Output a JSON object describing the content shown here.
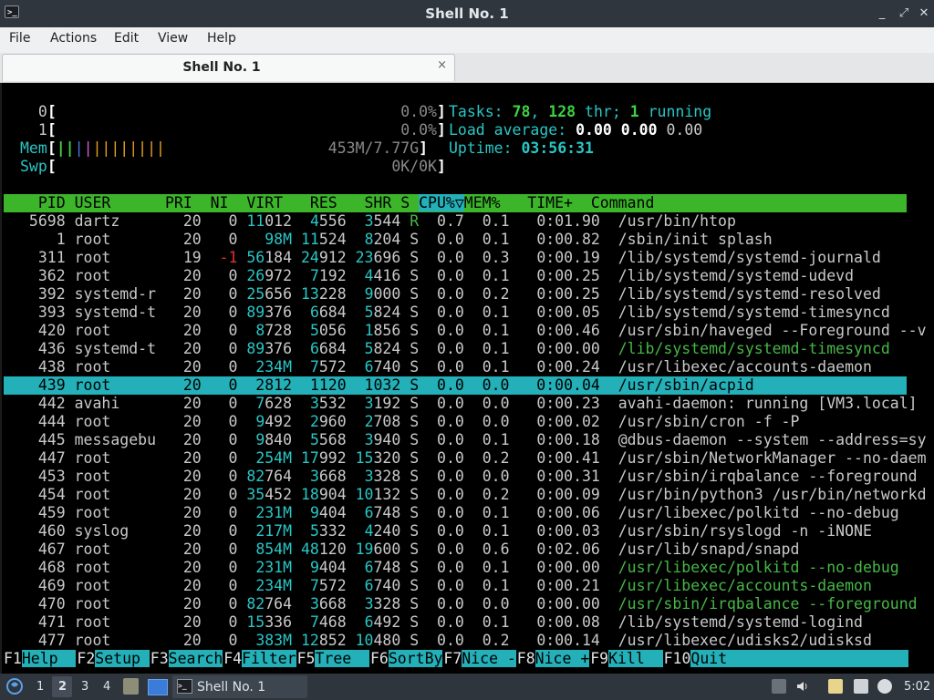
{
  "window": {
    "title": "Shell No. 1",
    "minimize": "_",
    "maximize": "⤢",
    "close": "✕"
  },
  "menu": {
    "items": [
      "File",
      "Actions",
      "Edit",
      "View",
      "Help"
    ]
  },
  "tab": {
    "label": "Shell No. 1",
    "close": "×"
  },
  "htop": {
    "cpu0": {
      "label": "0",
      "value": "0.0%"
    },
    "cpu1": {
      "label": "1",
      "value": "0.0%"
    },
    "mem": {
      "label": "Mem",
      "value": "453M/7.77G"
    },
    "swp": {
      "label": "Swp",
      "value": "0K/0K"
    },
    "tasks": {
      "label": "Tasks:",
      "count": "78",
      "thr": "128",
      "thr_label": "thr;",
      "running": "1",
      "running_label": "running"
    },
    "load": {
      "label": "Load average:",
      "v1": "0.00",
      "v2": "0.00",
      "v3": "0.00"
    },
    "uptime": {
      "label": "Uptime:",
      "value": "03:56:31"
    },
    "header": "  PID USER      PRI  NI  VIRT   RES   SHR S CPU%▽MEM%   TIME+  Command",
    "selected_pid": "439",
    "processes": [
      {
        "pid": "5698",
        "user": "dartz",
        "pri": "20",
        "ni": "0",
        "virt": "11012",
        "res": "4556",
        "shr": "3544",
        "s": "R",
        "cpu": "0.7",
        "mem": "0.1",
        "time": "0:01.90",
        "cmd": "/usr/bin/htop"
      },
      {
        "pid": "1",
        "user": "root",
        "pri": "20",
        "ni": "0",
        "virt": "98M",
        "res": "11524",
        "shr": "8204",
        "s": "S",
        "cpu": "0.0",
        "mem": "0.1",
        "time": "0:00.82",
        "cmd": "/sbin/init splash"
      },
      {
        "pid": "311",
        "user": "root",
        "pri": "19",
        "ni": "-1",
        "virt": "56184",
        "res": "24912",
        "shr": "23696",
        "s": "S",
        "cpu": "0.0",
        "mem": "0.3",
        "time": "0:00.19",
        "cmd": "/lib/systemd/systemd-journald"
      },
      {
        "pid": "362",
        "user": "root",
        "pri": "20",
        "ni": "0",
        "virt": "26972",
        "res": "7192",
        "shr": "4416",
        "s": "S",
        "cpu": "0.0",
        "mem": "0.1",
        "time": "0:00.25",
        "cmd": "/lib/systemd/systemd-udevd"
      },
      {
        "pid": "392",
        "user": "systemd-r",
        "pri": "20",
        "ni": "0",
        "virt": "25656",
        "res": "13228",
        "shr": "9000",
        "s": "S",
        "cpu": "0.0",
        "mem": "0.2",
        "time": "0:00.25",
        "cmd": "/lib/systemd/systemd-resolved"
      },
      {
        "pid": "393",
        "user": "systemd-t",
        "pri": "20",
        "ni": "0",
        "virt": "89376",
        "res": "6684",
        "shr": "5824",
        "s": "S",
        "cpu": "0.0",
        "mem": "0.1",
        "time": "0:00.05",
        "cmd": "/lib/systemd/systemd-timesyncd"
      },
      {
        "pid": "420",
        "user": "root",
        "pri": "20",
        "ni": "0",
        "virt": "8728",
        "res": "5056",
        "shr": "1856",
        "s": "S",
        "cpu": "0.0",
        "mem": "0.1",
        "time": "0:00.46",
        "cmd": "/usr/sbin/haveged --Foreground --v"
      },
      {
        "pid": "436",
        "user": "systemd-t",
        "pri": "20",
        "ni": "0",
        "virt": "89376",
        "res": "6684",
        "shr": "5824",
        "s": "S",
        "cpu": "0.0",
        "mem": "0.1",
        "time": "0:00.00",
        "cmd": "/lib/systemd/systemd-timesyncd",
        "thread": true
      },
      {
        "pid": "438",
        "user": "root",
        "pri": "20",
        "ni": "0",
        "virt": "234M",
        "res": "7572",
        "shr": "6740",
        "s": "S",
        "cpu": "0.0",
        "mem": "0.1",
        "time": "0:00.24",
        "cmd": "/usr/libexec/accounts-daemon"
      },
      {
        "pid": "439",
        "user": "root",
        "pri": "20",
        "ni": "0",
        "virt": "2812",
        "res": "1120",
        "shr": "1032",
        "s": "S",
        "cpu": "0.0",
        "mem": "0.0",
        "time": "0:00.04",
        "cmd": "/usr/sbin/acpid"
      },
      {
        "pid": "442",
        "user": "avahi",
        "pri": "20",
        "ni": "0",
        "virt": "7628",
        "res": "3532",
        "shr": "3192",
        "s": "S",
        "cpu": "0.0",
        "mem": "0.0",
        "time": "0:00.23",
        "cmd": "avahi-daemon: running [VM3.local]"
      },
      {
        "pid": "444",
        "user": "root",
        "pri": "20",
        "ni": "0",
        "virt": "9492",
        "res": "2960",
        "shr": "2708",
        "s": "S",
        "cpu": "0.0",
        "mem": "0.0",
        "time": "0:00.02",
        "cmd": "/usr/sbin/cron -f -P"
      },
      {
        "pid": "445",
        "user": "messagebu",
        "pri": "20",
        "ni": "0",
        "virt": "9840",
        "res": "5568",
        "shr": "3940",
        "s": "S",
        "cpu": "0.0",
        "mem": "0.1",
        "time": "0:00.18",
        "cmd": "@dbus-daemon --system --address=sy"
      },
      {
        "pid": "447",
        "user": "root",
        "pri": "20",
        "ni": "0",
        "virt": "254M",
        "res": "17992",
        "shr": "15320",
        "s": "S",
        "cpu": "0.0",
        "mem": "0.2",
        "time": "0:00.41",
        "cmd": "/usr/sbin/NetworkManager --no-daem"
      },
      {
        "pid": "453",
        "user": "root",
        "pri": "20",
        "ni": "0",
        "virt": "82764",
        "res": "3668",
        "shr": "3328",
        "s": "S",
        "cpu": "0.0",
        "mem": "0.0",
        "time": "0:00.31",
        "cmd": "/usr/sbin/irqbalance --foreground"
      },
      {
        "pid": "454",
        "user": "root",
        "pri": "20",
        "ni": "0",
        "virt": "35452",
        "res": "18904",
        "shr": "10132",
        "s": "S",
        "cpu": "0.0",
        "mem": "0.2",
        "time": "0:00.09",
        "cmd": "/usr/bin/python3 /usr/bin/networkd"
      },
      {
        "pid": "459",
        "user": "root",
        "pri": "20",
        "ni": "0",
        "virt": "231M",
        "res": "9404",
        "shr": "6748",
        "s": "S",
        "cpu": "0.0",
        "mem": "0.1",
        "time": "0:00.06",
        "cmd": "/usr/libexec/polkitd --no-debug"
      },
      {
        "pid": "460",
        "user": "syslog",
        "pri": "20",
        "ni": "0",
        "virt": "217M",
        "res": "5332",
        "shr": "4240",
        "s": "S",
        "cpu": "0.0",
        "mem": "0.1",
        "time": "0:00.03",
        "cmd": "/usr/sbin/rsyslogd -n -iNONE"
      },
      {
        "pid": "467",
        "user": "root",
        "pri": "20",
        "ni": "0",
        "virt": "854M",
        "res": "48120",
        "shr": "19600",
        "s": "S",
        "cpu": "0.0",
        "mem": "0.6",
        "time": "0:02.06",
        "cmd": "/usr/lib/snapd/snapd"
      },
      {
        "pid": "468",
        "user": "root",
        "pri": "20",
        "ni": "0",
        "virt": "231M",
        "res": "9404",
        "shr": "6748",
        "s": "S",
        "cpu": "0.0",
        "mem": "0.1",
        "time": "0:00.00",
        "cmd": "/usr/libexec/polkitd --no-debug",
        "thread": true
      },
      {
        "pid": "469",
        "user": "root",
        "pri": "20",
        "ni": "0",
        "virt": "234M",
        "res": "7572",
        "shr": "6740",
        "s": "S",
        "cpu": "0.0",
        "mem": "0.1",
        "time": "0:00.21",
        "cmd": "/usr/libexec/accounts-daemon",
        "thread": true
      },
      {
        "pid": "470",
        "user": "root",
        "pri": "20",
        "ni": "0",
        "virt": "82764",
        "res": "3668",
        "shr": "3328",
        "s": "S",
        "cpu": "0.0",
        "mem": "0.0",
        "time": "0:00.00",
        "cmd": "/usr/sbin/irqbalance --foreground",
        "thread": true
      },
      {
        "pid": "471",
        "user": "root",
        "pri": "20",
        "ni": "0",
        "virt": "15336",
        "res": "7468",
        "shr": "6492",
        "s": "S",
        "cpu": "0.0",
        "mem": "0.1",
        "time": "0:00.08",
        "cmd": "/lib/systemd/systemd-logind"
      },
      {
        "pid": "477",
        "user": "root",
        "pri": "20",
        "ni": "0",
        "virt": "383M",
        "res": "12852",
        "shr": "10480",
        "s": "S",
        "cpu": "0.0",
        "mem": "0.2",
        "time": "0:00.14",
        "cmd": "/usr/libexec/udisks2/udisksd"
      }
    ],
    "fkeys": [
      {
        "key": "F1",
        "label": "Help  "
      },
      {
        "key": "F2",
        "label": "Setup "
      },
      {
        "key": "F3",
        "label": "Search"
      },
      {
        "key": "F4",
        "label": "Filter"
      },
      {
        "key": "F5",
        "label": "Tree  "
      },
      {
        "key": "F6",
        "label": "SortBy"
      },
      {
        "key": "F7",
        "label": "Nice -"
      },
      {
        "key": "F8",
        "label": "Nice +"
      },
      {
        "key": "F9",
        "label": "Kill  "
      },
      {
        "key": "F10",
        "label": "Quit"
      }
    ]
  },
  "taskbar": {
    "workspaces": [
      "1",
      "2",
      "3",
      "4"
    ],
    "active_workspace": "2",
    "task": "Shell No. 1",
    "clock": "5:02"
  }
}
